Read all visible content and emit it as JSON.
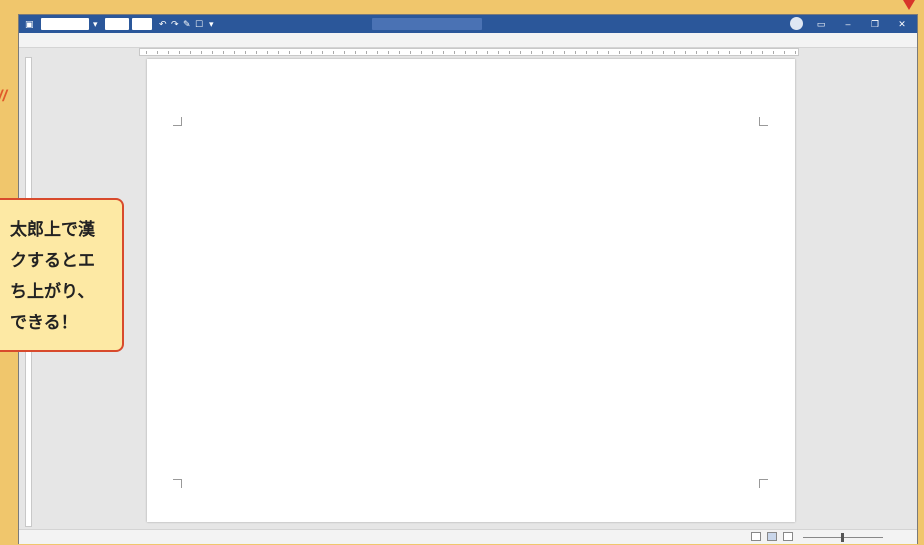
{
  "window": {
    "titlebar": {
      "autosave": "",
      "doc_box": "",
      "font_box": "",
      "title": "",
      "search_placeholder": "",
      "user": ""
    },
    "menu": [
      "",
      "",
      "",
      "",
      "",
      "",
      "",
      "",
      "",
      "",
      "",
      "",
      "",
      "",
      "",
      ""
    ],
    "menu_right": [
      "",
      ""
    ],
    "status": {
      "page": "",
      "words": "",
      "lang": "",
      "zoom": ""
    }
  },
  "kanbun_columns": [
    [
      "",
      "",
      "",
      "",
      ""
    ],
    [
      "",
      "",
      "",
      "",
      "",
      "",
      "",
      ""
    ],
    [
      "",
      ""
    ],
    [
      "",
      "",
      "",
      ""
    ],
    [
      "",
      "",
      "",
      "",
      "",
      "",
      "",
      "",
      "",
      "",
      "",
      "",
      "",
      ""
    ],
    [
      "",
      "",
      "",
      ""
    ],
    [
      "",
      "",
      "",
      "",
      "",
      "",
      "",
      "",
      "",
      ""
    ],
    [
      "",
      "",
      "",
      ""
    ],
    [
      "",
      "",
      "",
      "",
      "",
      "",
      "",
      "",
      ""
    ],
    [
      "",
      "",
      "",
      "",
      ""
    ],
    [
      "",
      "",
      "",
      ""
    ],
    [
      "",
      "",
      "",
      "",
      ""
    ],
    [
      "",
      "",
      "",
      ""
    ],
    [
      "",
      "",
      "",
      "",
      "",
      "",
      "",
      ""
    ],
    [
      "",
      "",
      "",
      ""
    ],
    [
      "",
      ""
    ],
    [
      "",
      "",
      "",
      "",
      "",
      "",
      "",
      ""
    ],
    [
      "",
      "",
      ""
    ],
    [
      "",
      "",
      "",
      ""
    ],
    [
      "",
      ""
    ],
    [
      "",
      ""
    ]
  ],
  "lone_chars": [
    "",
    ""
  ],
  "callout": {
    "lines": [
      "太郎上で漢",
      "クするとエ",
      "ち上がり、",
      "できる！"
    ]
  },
  "accent_colors": {
    "titlebar": "#2b579a",
    "callout_border": "#d84a2c",
    "callout_fill": "#fde9a4",
    "frame": "#f0c66c"
  }
}
